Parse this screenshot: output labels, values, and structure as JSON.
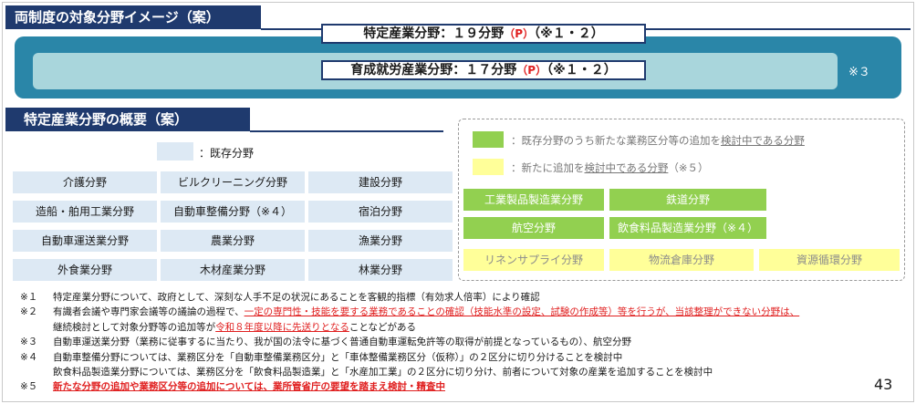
{
  "header": {
    "title": "両制度の対象分野イメージ（案）"
  },
  "tokutei": {
    "label": "特定産業分野：１９分野",
    "suffix": "（P）",
    "note": "（※１・２）"
  },
  "ikusei": {
    "label": "育成就労産業分野：１７分野",
    "suffix": "（P）",
    "note": "（※１・２）"
  },
  "band_note": "※３",
  "section": {
    "title": "特定産業分野の概要（案）"
  },
  "legend": {
    "existing": "：既存分野",
    "green_pre": "：既存分野のうち新たな業務区分等の追加を",
    "green_u": "検討中である分野",
    "yellow_pre": "：新たに追加を",
    "yellow_u": "検討中である分野",
    "yellow_post": "（※５）"
  },
  "existing_fields": [
    "介護分野",
    "ビルクリーニング分野",
    "建設分野",
    "造船・舶用工業分野",
    "自動車整備分野（※４）",
    "宿泊分野",
    "自動車運送業分野",
    "農業分野",
    "漁業分野",
    "外食業分野",
    "木材産業分野",
    "林業分野"
  ],
  "green_fields": [
    "工業製品製造業分野",
    "鉄道分野",
    "航空分野",
    "飲食料品製造業分野（※４）"
  ],
  "yellow_fields": [
    "リネンサプライ分野",
    "物流倉庫分野",
    "資源循環分野"
  ],
  "notes": {
    "n1_mark": "※１",
    "n1": "特定産業分野について、政府として、深刻な人手不足の状況にあることを客観的指標（有効求人倍率）により確認",
    "n2_mark": "※２",
    "n2_a": "有識者会議や専門家会議等の議論の過程で、",
    "n2_b": "一定の専門性・技能を要する業務であることの確認（技能水準の設定、試験の作成等）等を行うが、当該整理ができない分野は、",
    "n2_c": "継続検討として対象分野等の追加等が",
    "n2_d": "令和８年度以降に先送りとなる",
    "n2_e": "ことなどがある",
    "n3_mark": "※３",
    "n3": "自動車運送業分野（業務に従事するに当たり、我が国の法令に基づく普通自動車運転免許等の取得が前提となっているもの）、航空分野",
    "n4_mark": "※４",
    "n4_a": "自動車整備分野については、業務区分を「自動車整備業務区分」と「車体整備業務区分（仮称）」の２区分に切り分けることを検討中",
    "n4_b": "飲食料品製造業分野については、業務区分を「飲食料品製造業」と「水産加工業」の２区分に切り分け、前者について対象の産業を追加することを検討中",
    "n5_mark": "※５",
    "n5": "新たな分野の追加や業務区分等の追加については、業所管省庁の要望を踏まえ検討・精査中"
  },
  "page_number": "43",
  "colors": {
    "navy": "#1f3a6e",
    "teal": "#2a86a8",
    "light_teal": "#a9d6dc",
    "light_blue": "#dde9f4",
    "green": "#92d050",
    "yellow": "#ffff99",
    "red": "#e02020"
  }
}
